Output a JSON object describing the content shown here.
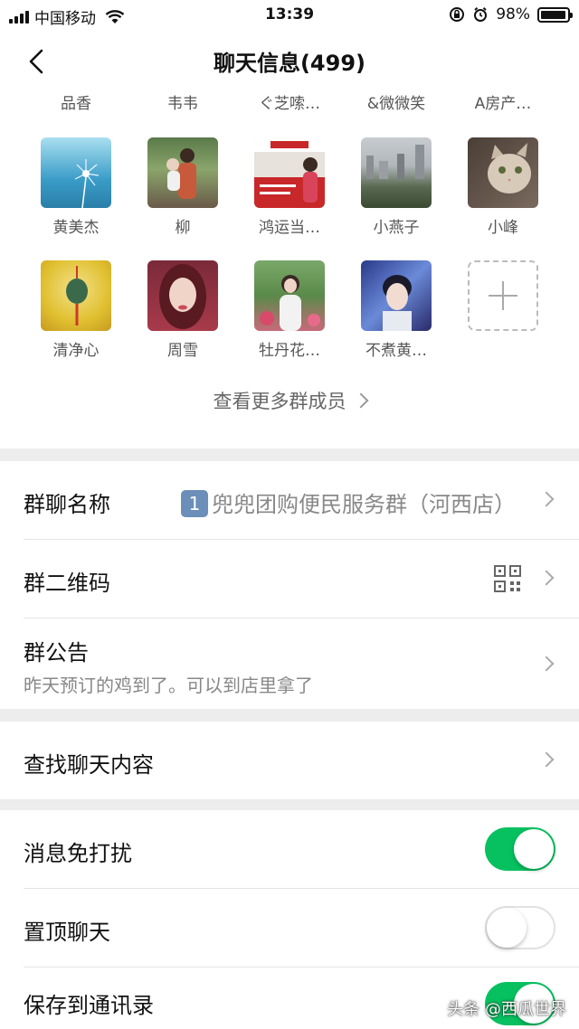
{
  "status_bar": {
    "carrier": "中国移动",
    "time": "13:39",
    "battery": "98%",
    "battery_level": 0.98
  },
  "nav": {
    "title": "聊天信息(499)"
  },
  "members": {
    "top_row_names": [
      "品香",
      "韦韦",
      "ぐ芝嗦…",
      "&微微笑",
      "A房产…"
    ],
    "row1": [
      {
        "name": "黄美杰",
        "avatar_color": "#6fb7d6"
      },
      {
        "name": "柳",
        "avatar_color": "#6f8a5a"
      },
      {
        "name": "鸿运当…",
        "avatar_color": "#d94a4a"
      },
      {
        "name": "小燕子",
        "avatar_color": "#8c9a8a"
      },
      {
        "name": "小峰",
        "avatar_color": "#9c8a78"
      }
    ],
    "row2": [
      {
        "name": "清净心",
        "avatar_color": "#e6c84a"
      },
      {
        "name": "周雪",
        "avatar_color": "#a83a4a"
      },
      {
        "name": "牡丹花…",
        "avatar_color": "#b86a7a"
      },
      {
        "name": "不煮黄…",
        "avatar_color": "#4a6ab8"
      }
    ],
    "view_more": "查看更多群成员"
  },
  "group_info": {
    "name_label": "群聊名称",
    "name_badge": "1",
    "name_value": "兜兜团购便民服务群（河西店）",
    "qr_label": "群二维码",
    "notice_label": "群公告",
    "notice_text": "昨天预订的鸡到了。可以到店里拿了"
  },
  "search": {
    "label": "查找聊天内容"
  },
  "toggles": {
    "mute_label": "消息免打扰",
    "mute_on": true,
    "pin_label": "置顶聊天",
    "pin_on": false,
    "save_label": "保存到通讯录",
    "save_on": true
  },
  "watermark": "头条 @西瓜世界",
  "colors": {
    "accent_green": "#07c160",
    "background": "#ededed"
  }
}
